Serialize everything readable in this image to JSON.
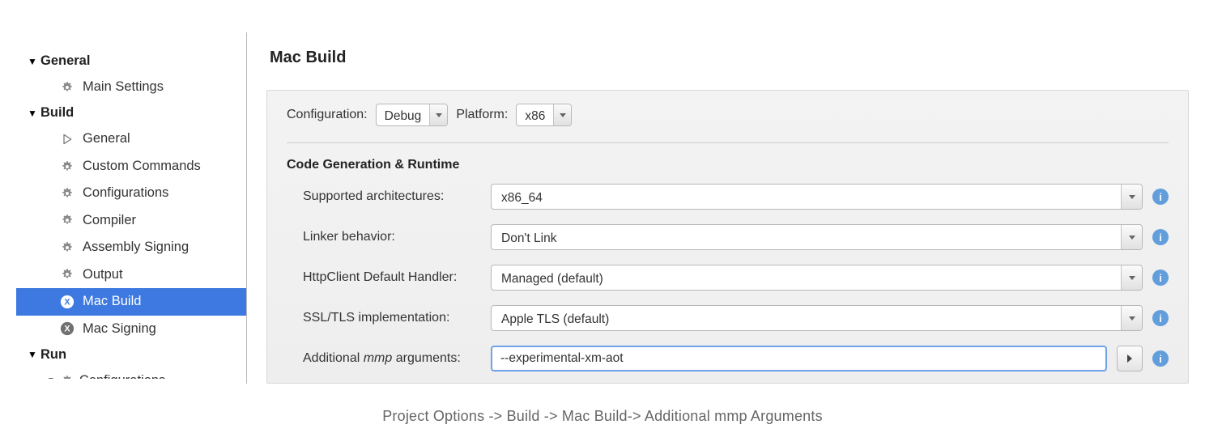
{
  "sidebar": {
    "groups": [
      {
        "label": "General",
        "items": [
          {
            "label": "Main Settings",
            "icon": "gear"
          }
        ]
      },
      {
        "label": "Build",
        "items": [
          {
            "label": "General",
            "icon": "play"
          },
          {
            "label": "Custom Commands",
            "icon": "gear"
          },
          {
            "label": "Configurations",
            "icon": "gear"
          },
          {
            "label": "Compiler",
            "icon": "gear"
          },
          {
            "label": "Assembly Signing",
            "icon": "gear"
          },
          {
            "label": "Output",
            "icon": "gear"
          },
          {
            "label": "Mac Build",
            "icon": "x-badge",
            "selected": true
          },
          {
            "label": "Mac Signing",
            "icon": "x-badge"
          }
        ]
      },
      {
        "label": "Run",
        "items": [
          {
            "label": "Configurations",
            "icon": "gear",
            "truncated": true
          }
        ]
      }
    ]
  },
  "main": {
    "title": "Mac Build",
    "configBar": {
      "configurationLabel": "Configuration:",
      "configurationValue": "Debug",
      "platformLabel": "Platform:",
      "platformValue": "x86"
    },
    "sectionTitle": "Code Generation & Runtime",
    "rows": {
      "arch": {
        "label": "Supported architectures:",
        "value": "x86_64"
      },
      "linker": {
        "label": "Linker behavior:",
        "value": "Don't Link"
      },
      "http": {
        "label": "HttpClient Default Handler:",
        "value": "Managed (default)"
      },
      "ssl": {
        "label": "SSL/TLS implementation:",
        "value": "Apple TLS (default)"
      },
      "mmp": {
        "labelPrefix": "Additional ",
        "labelItalic": "mmp",
        "labelSuffix": " arguments:",
        "value": "--experimental-xm-aot"
      }
    }
  },
  "caption": "Project Options -> Build -> Mac Build-> Additional mmp Arguments"
}
